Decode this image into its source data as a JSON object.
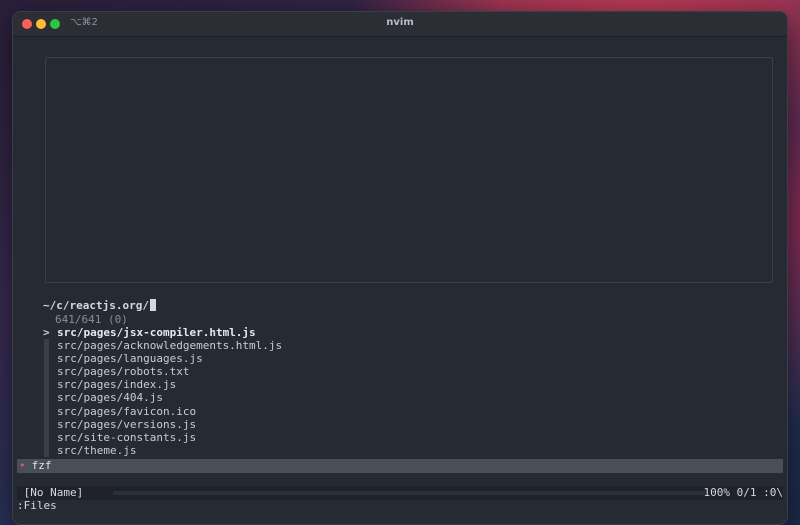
{
  "window": {
    "shortcut": "⌥⌘2",
    "title": "nvim"
  },
  "fzf": {
    "prompt": "~/c/reactjs.org/",
    "count": "641/641 (0)",
    "selected_marker": ">",
    "files": [
      "src/pages/jsx-compiler.html.js",
      "src/pages/acknowledgements.html.js",
      "src/pages/languages.js",
      "src/pages/robots.txt",
      "src/pages/index.js",
      "src/pages/404.js",
      "src/pages/favicon.ico",
      "src/pages/versions.js",
      "src/site-constants.js",
      "src/theme.js"
    ],
    "buffer_label": "fzf"
  },
  "statusline": {
    "left": " [No Name]",
    "right": "100% 0/1 :0\\"
  },
  "cmdline": ":Files",
  "colors": {
    "terminal_bg": "#262a33",
    "fzf_bar_bg": "#4a4e56",
    "accent_red": "#e05561"
  }
}
